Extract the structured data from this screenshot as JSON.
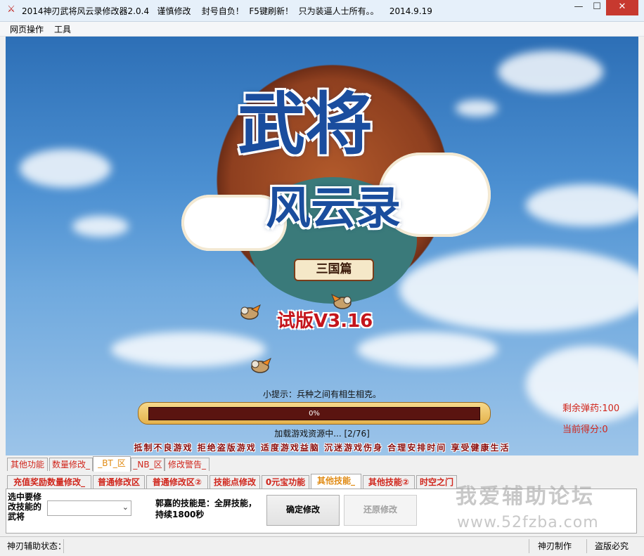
{
  "window": {
    "title": "2014神刃武将风云录修改器2.0.4   谨慎修改    封号自负！  F5键刷新！  只为装逼人士所有。。    2014.9.19",
    "icon": "app-logo-icon",
    "controls": {
      "minimize": "—",
      "maximize": "☐",
      "close": "✕"
    }
  },
  "menu": {
    "items": [
      "网页操作",
      "工具"
    ]
  },
  "game": {
    "logo": {
      "line1": "武将",
      "line2": "风云录",
      "subtitle": "三国篇"
    },
    "version": "试版V3.16",
    "tip": "小提示：兵种之间有相生相克。",
    "progress": {
      "value": 0,
      "label": "0%"
    },
    "loading": "加载游戏资源中...   [2/76]",
    "warning": "抵制不良游戏  拒绝盗版游戏  适度游戏益脑  沉迷游戏伤身  合理安排时间  享受健康生活",
    "ammo": "剩余弹药:100",
    "score": "当前得分:0"
  },
  "tabs_row1": [
    {
      "label": "其他功能",
      "color": "#d0261c"
    },
    {
      "label": "数量修改_",
      "color": "#d0261c"
    },
    {
      "label": "_BT_区",
      "color": "#e08a12",
      "active": true
    },
    {
      "label": "_NB_区",
      "color": "#d0261c"
    },
    {
      "label": "修改警告_",
      "color": "#d0261c"
    }
  ],
  "tabs_row2": [
    {
      "label": "充值奖励数量修改_"
    },
    {
      "label": "普通修改区"
    },
    {
      "label": "普通修改区②"
    },
    {
      "label": "技能点修改"
    },
    {
      "label": "0元宝功能"
    },
    {
      "label": "其他技能_",
      "active": true
    },
    {
      "label": "其他技能②"
    },
    {
      "label": "时空之门"
    }
  ],
  "panel": {
    "select_label": "选中要修改技能的武将",
    "select_value": "",
    "skill_desc": "郭嘉的技能是：全屏技能，持续1800秒",
    "confirm_button": "确定修改",
    "restore_button": "还原修改"
  },
  "watermark": {
    "line1": "我爱辅助论坛",
    "line2": "www.52fzba.com"
  },
  "status": {
    "left": "神刃辅助状态：",
    "middle": "神刃制作",
    "right": "盗版必究"
  }
}
